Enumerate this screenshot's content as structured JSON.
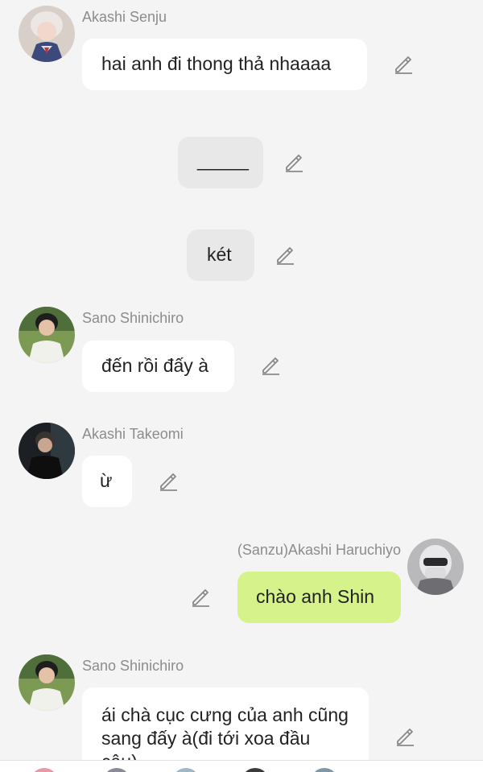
{
  "messages": [
    {
      "sender": "Akashi Senju",
      "text": "hai anh đi thong thả nhaaaa"
    },
    {
      "text": "_____"
    },
    {
      "text": "két"
    },
    {
      "sender": "Sano Shinichiro",
      "text": "đến rồi đấy à"
    },
    {
      "sender": "Akashi Takeomi",
      "text": "ừ"
    },
    {
      "sender": "(Sanzu)Akashi Haruchiyo",
      "text": "chào anh Shin"
    },
    {
      "sender": "Sano Shinichiro",
      "text": "ái chà cục cưng của anh cũng sang đấy à(đi tới xoa đầu cậu)"
    }
  ],
  "colors": {
    "background": "#f4f4f4",
    "bubble_other": "#ffffff",
    "bubble_center": "#e8e8e8",
    "bubble_self": "#d6f28a",
    "sender_name": "#8c8c8c"
  },
  "icons": {
    "edit": "pencil-icon"
  }
}
